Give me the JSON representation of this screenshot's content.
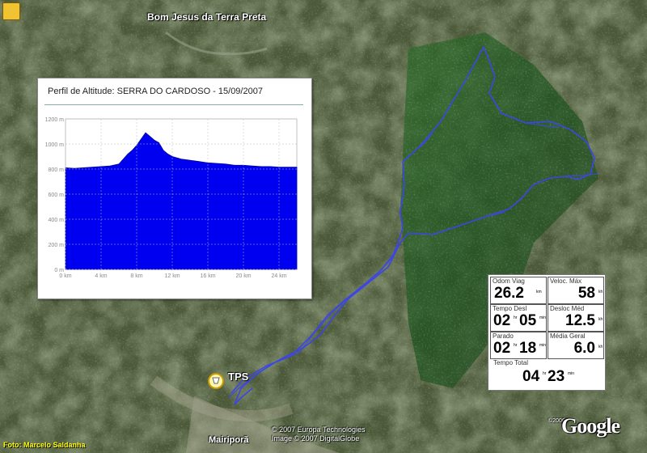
{
  "map": {
    "town_top": "Bom Jesus da Terra Preta",
    "town_bottom": "Mairiporã",
    "waypoint": "TPS",
    "credits": [
      "© 2007 Europa Technologies",
      "Image © 2007 DigitalGlobe"
    ],
    "google_logo": "Google",
    "google_year": "©2006",
    "photo_credit": "Foto: Marcelo Saldanha",
    "track_color": "#3c46e6"
  },
  "profile": {
    "title": "Perfil de Altitude: SERRA DO CARDOSO - 15/09/2007",
    "fill_color": "#0000f0"
  },
  "chart_data": {
    "type": "area",
    "title": "Perfil de Altitude: SERRA DO CARDOSO - 15/09/2007",
    "ylim": [
      0,
      1200
    ],
    "xlim": [
      0,
      26
    ],
    "yticks": [
      "0 m",
      "200 m",
      "400 m",
      "600 m",
      "800 m",
      "1000 m",
      "1200 m"
    ],
    "xticks": [
      "0 km",
      "4 km",
      "8 km",
      "12 km",
      "16 km",
      "20 km",
      "24 km"
    ],
    "grid": true,
    "x": [
      0,
      1,
      2,
      3,
      4,
      5,
      6,
      6.5,
      7,
      7.5,
      8,
      8.5,
      9,
      9.5,
      10,
      10.5,
      11,
      11.5,
      12,
      13,
      14,
      15,
      16,
      17,
      18,
      19,
      20,
      21,
      22,
      23,
      24,
      25,
      26
    ],
    "y": [
      810,
      805,
      810,
      815,
      820,
      825,
      840,
      880,
      920,
      950,
      990,
      1040,
      1090,
      1060,
      1030,
      1010,
      950,
      920,
      900,
      880,
      870,
      860,
      850,
      845,
      840,
      830,
      830,
      825,
      820,
      820,
      815,
      815,
      815
    ]
  },
  "stats": {
    "odometer": {
      "label": "Odom Viag",
      "value": "26.2",
      "unit": "km"
    },
    "max_speed": {
      "label": "Veloc. Máx",
      "value": "58",
      "unit": "kh"
    },
    "moving_time": {
      "label": "Tempo Desl",
      "h": "02",
      "m": "05",
      "units": [
        "hr",
        "min"
      ]
    },
    "avg_moving": {
      "label": "Desloc Méd",
      "value": "12.5",
      "unit": "kh"
    },
    "stopped": {
      "label": "Parado",
      "h": "02",
      "m": "18",
      "units": [
        "hr",
        "min"
      ]
    },
    "avg_overall": {
      "label": "Média Geral",
      "value": "6.0",
      "unit": "kh"
    },
    "total_time": {
      "label": "Tempo Total",
      "h": "04",
      "m": "23",
      "units": [
        "hr",
        "min"
      ]
    }
  }
}
